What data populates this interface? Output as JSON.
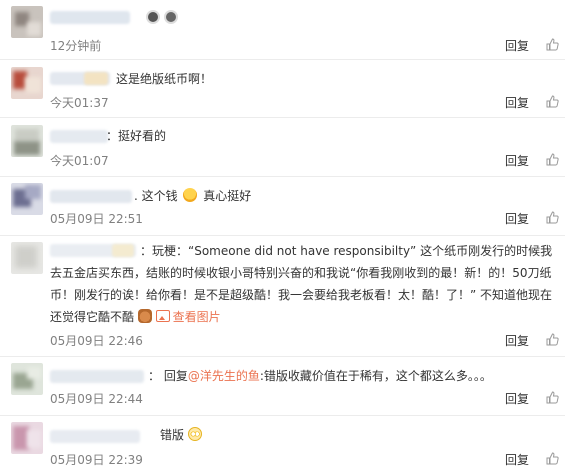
{
  "comments": [
    {
      "text": "",
      "time": "12分钟前",
      "reply_label": "回复"
    },
    {
      "text": "这是绝版纸币啊！",
      "time": "今天01:37",
      "reply_label": "回复"
    },
    {
      "text": "：挺好看的",
      "time": "今天01:07",
      "reply_label": "回复"
    },
    {
      "text": ".  这个钱",
      "text_after_emoji": "真心挺好",
      "time": "05月09日 22:51",
      "reply_label": "回复"
    },
    {
      "text": "：玩梗：“Someone did not have responsibilty” 这个纸币刚发行的时候我去五金店买东西，结账的时候收银小哥特别兴奋的和我说“你看我刚收到的最！新！的！50刀纸币！刚发行的诶！给你看！是不是超级酷！我一会要给我老板看！太！酷！了！” 不知道他现在还觉得它酷不酷",
      "view_image_label": "查看图片",
      "time": "05月09日 22:46",
      "reply_label": "回复"
    },
    {
      "text_prefix": "：  回复",
      "mention": "@洋先生的鱼",
      "text": ":错版收藏价值在于稀有，这个都这么多。。。",
      "time": "05月09日 22:44",
      "reply_label": "回复"
    },
    {
      "text": "错版",
      "time": "05月09日 22:39",
      "reply_label": "回复"
    }
  ],
  "icons": {
    "like": "thumbs-up-icon",
    "emoji": "emoji-icon",
    "picture": "picture-icon"
  },
  "colors": {
    "link": "#eb7350",
    "time": "#808080",
    "divider": "#ececec"
  }
}
